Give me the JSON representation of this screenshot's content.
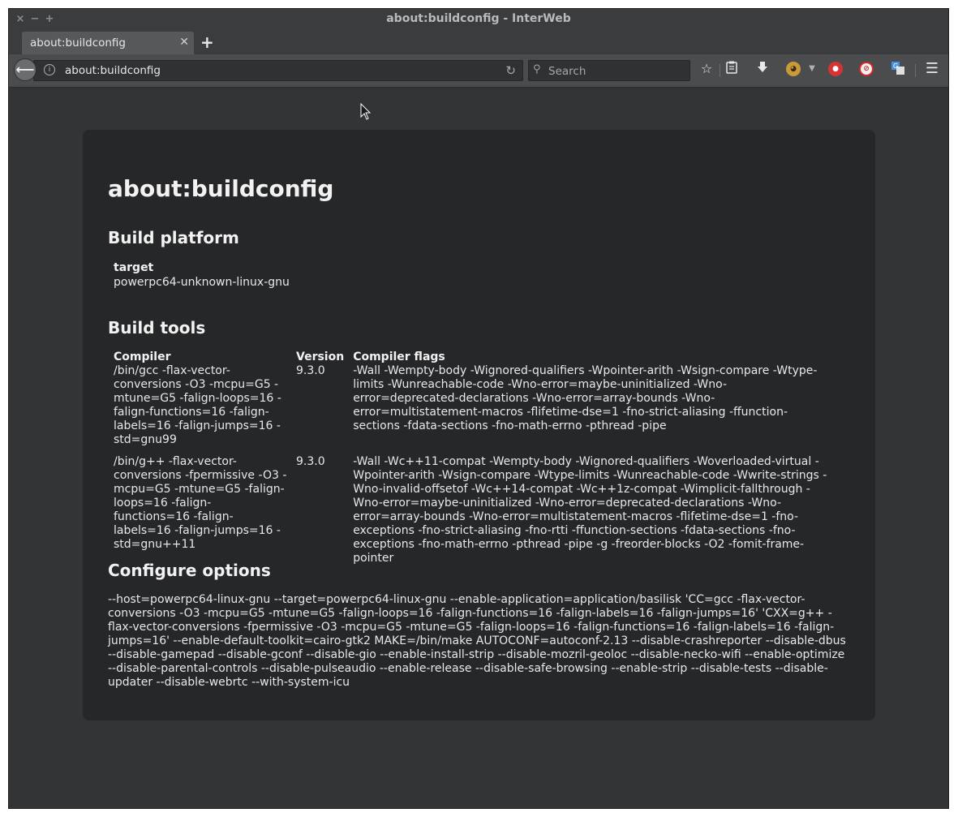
{
  "window": {
    "title": "about:buildconfig - InterWeb",
    "controls": [
      "×",
      "−",
      "+"
    ]
  },
  "tabs": [
    {
      "label": "about:buildconfig",
      "close": "✕"
    }
  ],
  "new_tab": "+",
  "navbar": {
    "back": "⟵",
    "url": "about:buildconfig",
    "search_placeholder": "Search",
    "icons": [
      "star-icon",
      "reader-icon",
      "download-icon",
      "monkey-extension-icon",
      "dropdown-arrow-icon",
      "red-extension-icon",
      "blocked-extension-icon",
      "translate-extension-icon",
      "hamburger-menu-icon"
    ]
  },
  "page": {
    "title": "about:buildconfig",
    "build_platform": {
      "heading": "Build platform",
      "target_label": "target",
      "target_value": "powerpc64-unknown-linux-gnu"
    },
    "build_tools": {
      "heading": "Build tools",
      "columns": [
        "Compiler",
        "Version",
        "Compiler flags"
      ],
      "rows": [
        {
          "compiler": "/bin/gcc -flax-vector-conversions -O3 -mcpu=G5 -mtune=G5 -falign-loops=16 -falign-functions=16 -falign-labels=16 -falign-jumps=16 -std=gnu99",
          "version": "9.3.0",
          "flags": "-Wall -Wempty-body -Wignored-qualifiers -Wpointer-arith -Wsign-compare -Wtype-limits -Wunreachable-code -Wno-error=maybe-uninitialized -Wno-error=deprecated-declarations -Wno-error=array-bounds -Wno-error=multistatement-macros -flifetime-dse=1 -fno-strict-aliasing -ffunction-sections -fdata-sections -fno-math-errno -pthread -pipe"
        },
        {
          "compiler": "/bin/g++ -flax-vector-conversions -fpermissive -O3 -mcpu=G5 -mtune=G5 -falign-loops=16 -falign-functions=16 -falign-labels=16 -falign-jumps=16 -std=gnu++11",
          "version": "9.3.0",
          "flags": "-Wall -Wc++11-compat -Wempty-body -Wignored-qualifiers -Woverloaded-virtual -Wpointer-arith -Wsign-compare -Wtype-limits -Wunreachable-code -Wwrite-strings -Wno-invalid-offsetof -Wc++14-compat -Wc++1z-compat -Wimplicit-fallthrough -Wno-error=maybe-uninitialized -Wno-error=deprecated-declarations -Wno-error=array-bounds -Wno-error=multistatement-macros -flifetime-dse=1 -fno-exceptions -fno-strict-aliasing -fno-rtti -ffunction-sections -fdata-sections -fno-exceptions -fno-math-errno -pthread -pipe -g -freorder-blocks -O2 -fomit-frame-pointer"
        }
      ]
    },
    "configure_options": {
      "heading": "Configure options",
      "text": "--host=powerpc64-linux-gnu --target=powerpc64-linux-gnu --enable-application=application/basilisk 'CC=gcc -flax-vector-conversions -O3 -mcpu=G5 -mtune=G5 -falign-loops=16 -falign-functions=16 -falign-labels=16 -falign-jumps=16' 'CXX=g++ -flax-vector-conversions -fpermissive -O3 -mcpu=G5 -mtune=G5 -falign-loops=16 -falign-functions=16 -falign-labels=16 -falign-jumps=16' --enable-default-toolkit=cairo-gtk2 MAKE=/bin/make AUTOCONF=autoconf-2.13 --disable-crashreporter --disable-dbus --disable-gamepad --disable-gconf --disable-gio --enable-install-strip --disable-mozril-geoloc --disable-necko-wifi --enable-optimize --disable-parental-controls --disable-pulseaudio --enable-release --disable-safe-browsing --enable-strip --disable-tests --disable-updater --disable-webrtc --with-system-icu"
    }
  }
}
